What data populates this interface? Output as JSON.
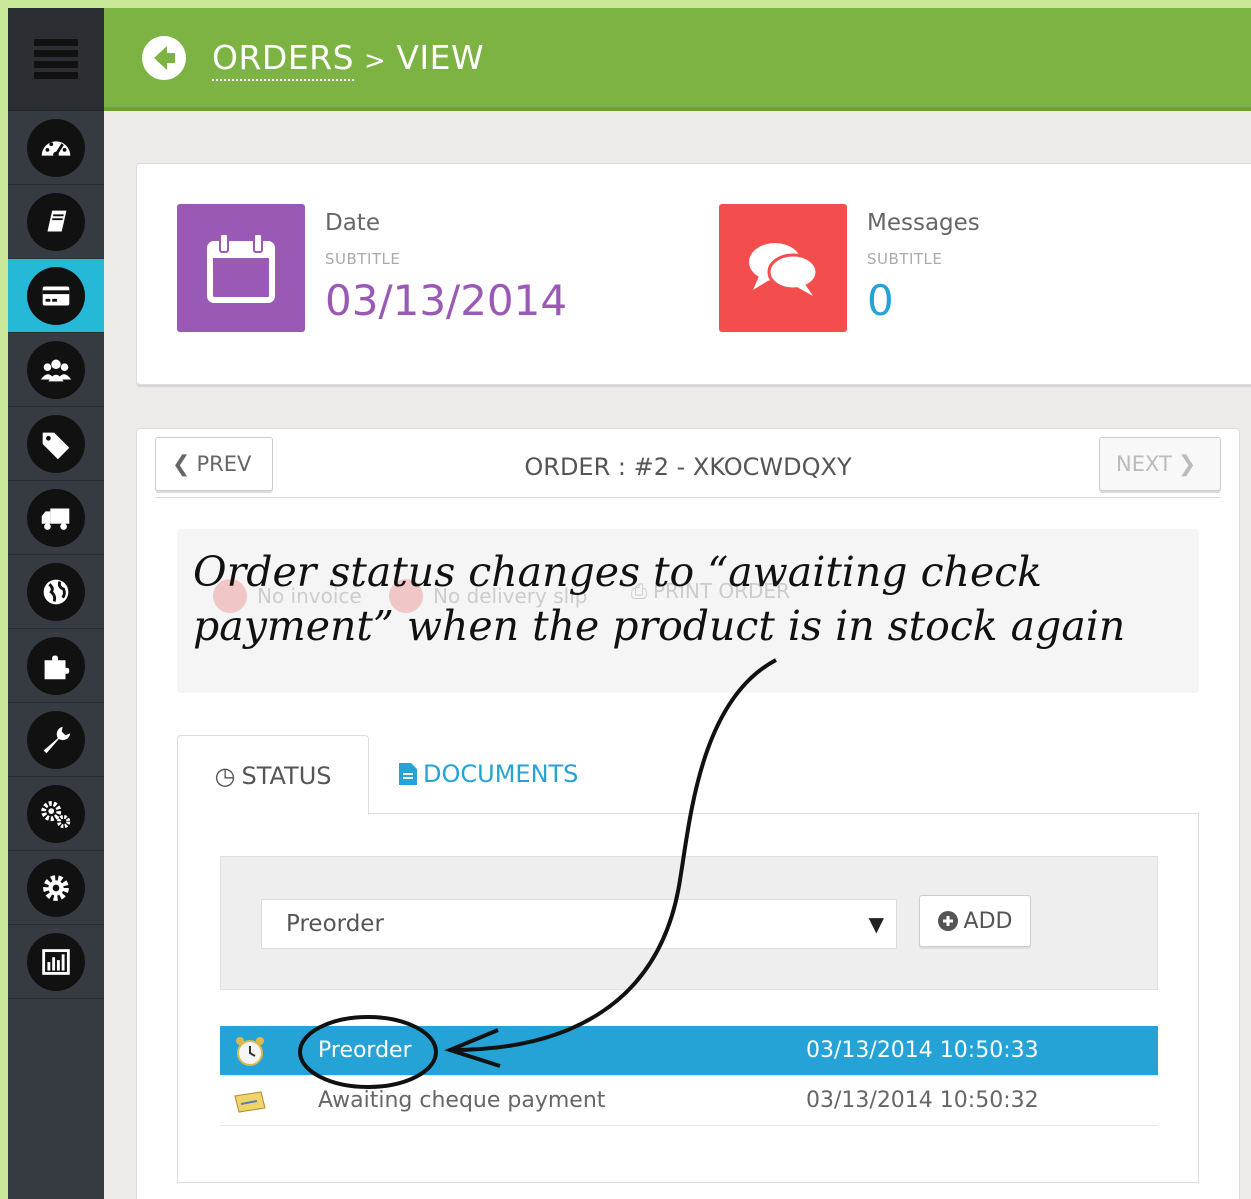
{
  "header": {
    "breadcrumb_section": "ORDERS",
    "breadcrumb_separator": ">",
    "breadcrumb_page": "VIEW",
    "back_icon": "arrow-left-circle-icon"
  },
  "sidebar": {
    "menu_icon": "hamburger-icon",
    "active_index": 2,
    "items": [
      {
        "icon": "dashboard-icon"
      },
      {
        "icon": "catalog-book-icon"
      },
      {
        "icon": "orders-credit-card-icon"
      },
      {
        "icon": "customers-icon"
      },
      {
        "icon": "price-tags-icon"
      },
      {
        "icon": "shipping-truck-icon"
      },
      {
        "icon": "localization-globe-icon"
      },
      {
        "icon": "modules-puzzle-icon"
      },
      {
        "icon": "preferences-wrench-icon"
      },
      {
        "icon": "advanced-parameters-cogs-icon"
      },
      {
        "icon": "administration-cog-icon"
      },
      {
        "icon": "stats-bar-chart-icon"
      }
    ]
  },
  "kpis": {
    "date": {
      "title": "Date",
      "subtitle": "SUBTITLE",
      "value": "03/13/2014",
      "color": "#9b59b6",
      "icon": "calendar-icon"
    },
    "messages": {
      "title": "Messages",
      "subtitle": "SUBTITLE",
      "value": "0",
      "color": "#f44d4d",
      "icon": "chat-bubbles-icon"
    }
  },
  "order": {
    "prev_label": "PREV",
    "next_label": "NEXT",
    "title": "ORDER : #2 - XKOCWDQXY",
    "actions": {
      "no_invoice": "No invoice",
      "no_delivery_slip": "No delivery slip",
      "print_order": "PRINT ORDER"
    }
  },
  "annotation": {
    "text": "Order status changes to “awaiting check payment” when the product is in stock again"
  },
  "tabs": {
    "status": "STATUS",
    "documents": "DOCUMENTS"
  },
  "status_form": {
    "selected": "Preorder",
    "add_label": "ADD"
  },
  "history": [
    {
      "icon": "alarm-clock-icon",
      "status": "Preorder",
      "date": "03/13/2014 10:50:33"
    },
    {
      "icon": "cheque-icon",
      "status": "Awaiting cheque payment",
      "date": "03/13/2014 10:50:32"
    }
  ],
  "colors": {
    "header_green": "#7cb342",
    "accent_blue": "#25a3d7",
    "sidebar_dark": "#363a41"
  }
}
